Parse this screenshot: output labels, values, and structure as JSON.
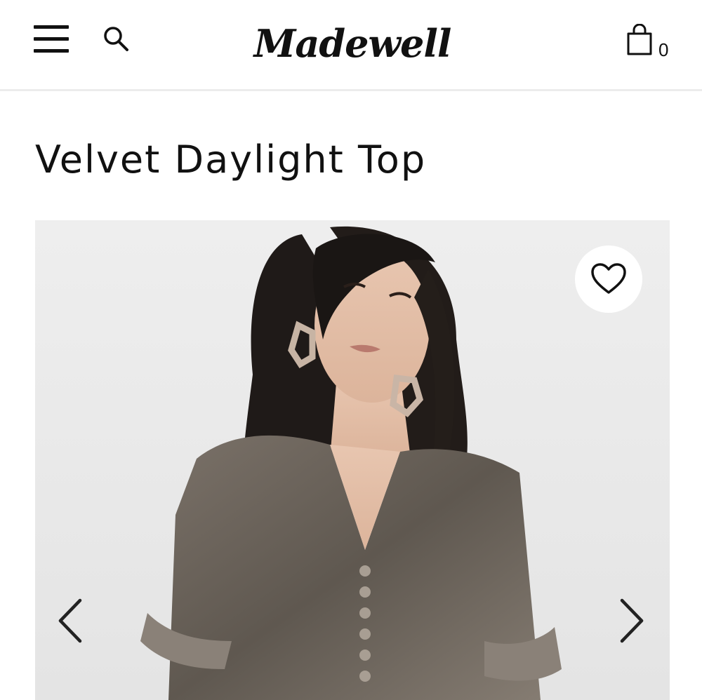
{
  "header": {
    "menu_icon": "hamburger-menu-icon",
    "search_icon": "search-icon",
    "logo_text": "Madewell",
    "bag_icon": "shopping-bag-icon",
    "bag_count": "0"
  },
  "product": {
    "title": "Velvet Daylight Top"
  },
  "gallery": {
    "image_alt": "Model wearing velvet top",
    "favorite_icon": "heart-icon",
    "prev_icon": "chevron-left-icon",
    "next_icon": "chevron-right-icon"
  },
  "colors": {
    "text": "#111111",
    "header_border": "#ececec",
    "image_bg": "#e9e9e9",
    "velvet": "#6e655d"
  }
}
